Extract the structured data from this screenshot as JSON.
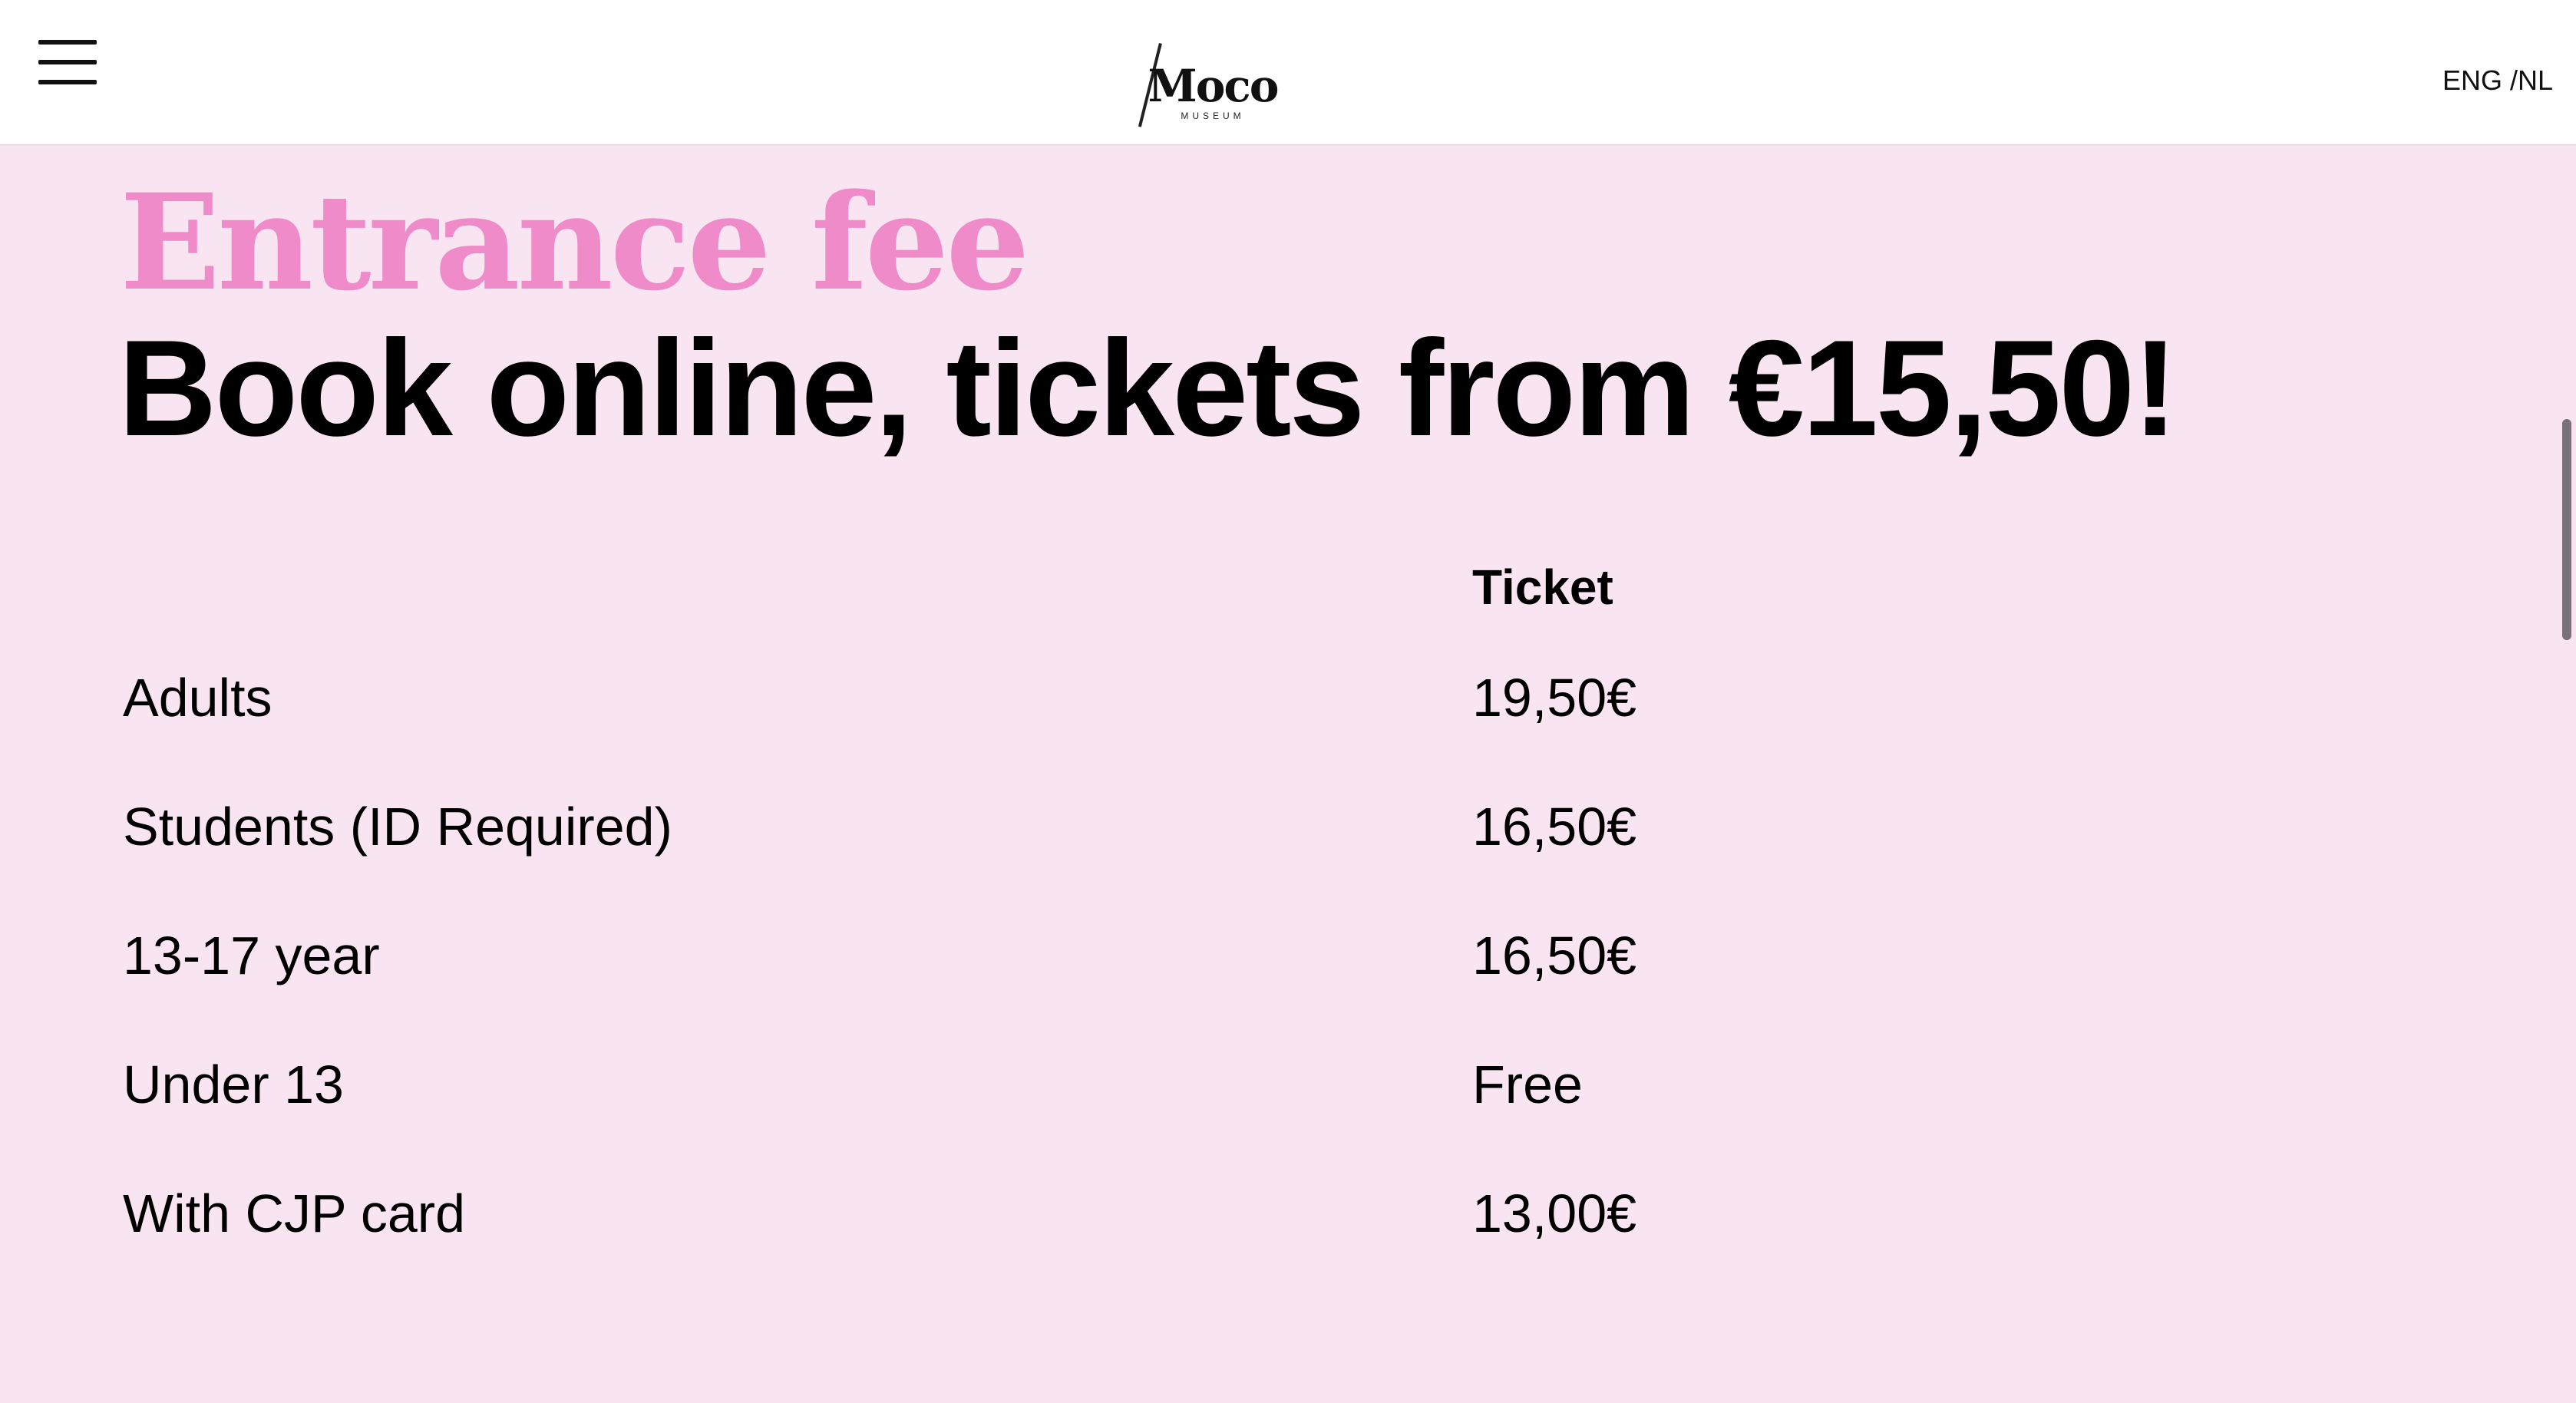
{
  "header": {
    "logo_word": "Moco",
    "logo_sub": "MUSEUM",
    "lang_en": "ENG",
    "lang_sep": " /",
    "lang_nl": "NL"
  },
  "main": {
    "kicker": "Entrance fee",
    "headline": "Book online, tickets from €15,50!",
    "column_header": "Ticket",
    "rows": [
      {
        "label": "Adults",
        "price": "19,50€"
      },
      {
        "label": "Students (ID Required)",
        "price": "16,50€"
      },
      {
        "label": "13-17 year",
        "price": "16,50€"
      },
      {
        "label": "Under 13",
        "price": "Free"
      },
      {
        "label": "With CJP card",
        "price": "13,00€"
      }
    ]
  },
  "colors": {
    "page_background": "#f9e5f1",
    "kicker_pink": "#ef8bc8",
    "text": "#000000"
  },
  "icons": {
    "menu": "hamburger-menu-icon"
  }
}
